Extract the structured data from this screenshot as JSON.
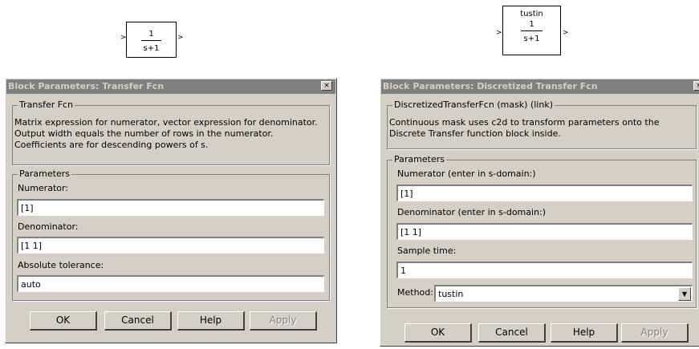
{
  "continuous_block": {
    "numerator": "1",
    "denominator": "s+1",
    "in_port": ">",
    "out_port": ">"
  },
  "discrete_block": {
    "method": "tustin",
    "numerator": "1",
    "denominator": "s+1",
    "in_port": ">",
    "out_port": ">"
  },
  "dialog_tf": {
    "title": "Block Parameters: Transfer Fcn",
    "close_glyph": "×",
    "group_title": "Transfer Fcn",
    "description": "Matrix expression for numerator, vector expression for denominator. Output width equals the number of rows in the numerator.  Coefficients are for descending powers of s.",
    "params_title": "Parameters",
    "numerator_label": "Numerator:",
    "numerator_value": "[1]",
    "denominator_label": "Denominator:",
    "denominator_value": "[1 1]",
    "tolerance_label": "Absolute tolerance:",
    "tolerance_value": "auto",
    "buttons": {
      "ok": "OK",
      "cancel": "Cancel",
      "help": "Help",
      "apply": "Apply"
    }
  },
  "dialog_dtf": {
    "title": "Block Parameters: Discretized Transfer Fcn",
    "close_glyph": "×",
    "group_title": "DiscretizedTransferFcn (mask) (link)",
    "description": "Continuous mask uses c2d to transform parameters onto the Discrete Transfer function block inside.",
    "params_title": "Parameters",
    "numerator_label": "Numerator (enter in s-domain:)",
    "numerator_value": "[1]",
    "denominator_label": "Denominator (enter in s-domain:)",
    "denominator_value": "[1 1]",
    "sample_label": "Sample time:",
    "sample_value": "1",
    "method_label": "Method:",
    "method_value": "tustin",
    "dropdown_glyph": "▼",
    "buttons": {
      "ok": "OK",
      "cancel": "Cancel",
      "help": "Help",
      "apply": "Apply"
    }
  }
}
